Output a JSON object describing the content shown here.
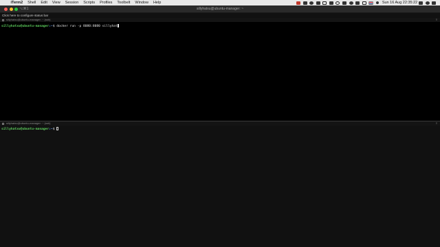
{
  "menubar": {
    "apple_glyph": "",
    "items": [
      "iTerm2",
      "Shell",
      "Edit",
      "View",
      "Session",
      "Scripts",
      "Profiles",
      "Toolbelt",
      "Window",
      "Help"
    ],
    "clock": "Sun 16 Aug  22:35:22"
  },
  "window": {
    "shortcut": "⌥⌘1",
    "title": "sillyhatxu@ubuntu-manager: ~"
  },
  "statusbar": {
    "text": "Click here to configure status bar"
  },
  "panes": [
    {
      "header": "sillyhatxu@ubuntu-manager: ~ (ssh)",
      "menu_glyph": "≡",
      "prompt_user": "sillyhatxu@ubuntu-manager",
      "prompt_path": ":~",
      "prompt_symbol": "$",
      "command": "docker run -p 8080:8080 sillyhat"
    },
    {
      "header": "sillyhatxu@ubuntu-manager: ~ (ssh)",
      "menu_glyph": "≡",
      "prompt_user": "sillyhatxu@ubuntu-manager",
      "prompt_path": ":~",
      "prompt_symbol": "$",
      "command": ""
    }
  ]
}
